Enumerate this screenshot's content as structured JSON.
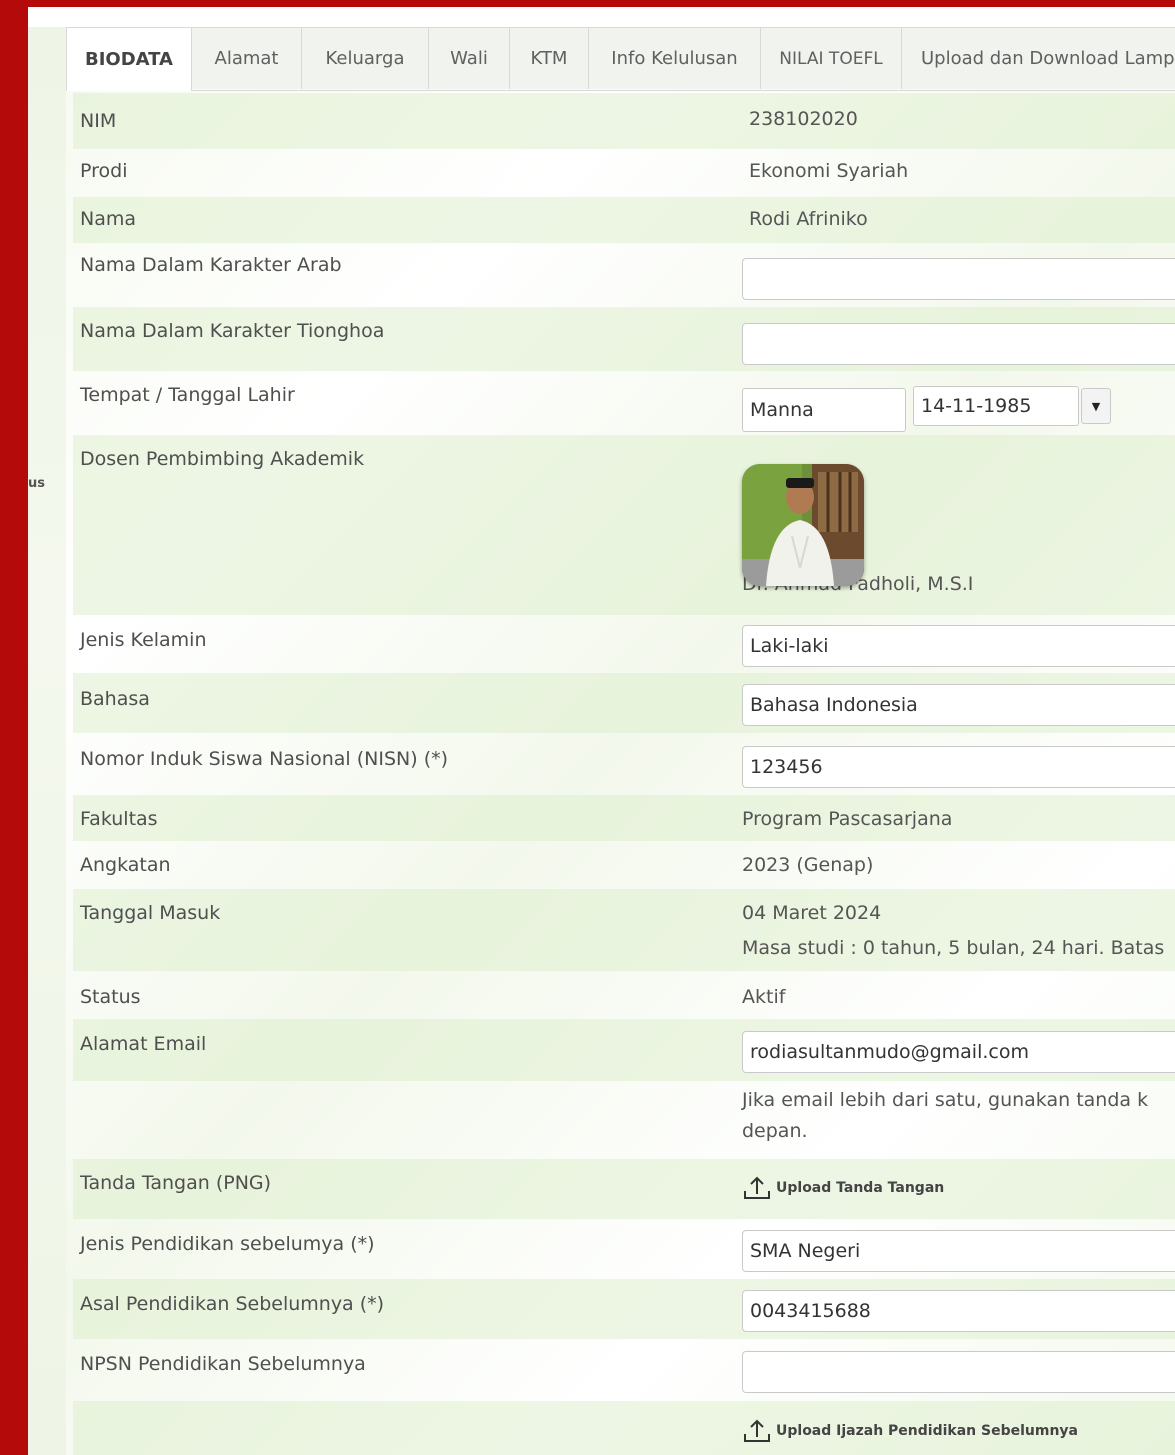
{
  "sidebar": {
    "partial_text": "us"
  },
  "tabs": [
    {
      "label": "BIODATA",
      "active": true
    },
    {
      "label": "Alamat"
    },
    {
      "label": "Keluarga"
    },
    {
      "label": "Wali"
    },
    {
      "label": "KTM"
    },
    {
      "label": "Info Kelulusan"
    },
    {
      "label": "NILAI TOEFL"
    },
    {
      "label": "Upload dan Download Lamp"
    }
  ],
  "form": {
    "nim": {
      "label": "NIM",
      "value": "238102020"
    },
    "prodi": {
      "label": "Prodi",
      "value": "Ekonomi Syariah"
    },
    "nama": {
      "label": "Nama",
      "value": "Rodi Afriniko"
    },
    "nama_arab": {
      "label": "Nama Dalam Karakter Arab",
      "value": ""
    },
    "nama_tionghoa": {
      "label": "Nama Dalam Karakter Tionghoa",
      "value": ""
    },
    "ttl": {
      "label": "Tempat / Tanggal Lahir",
      "tempat": "Manna",
      "tanggal": "14-11-1985"
    },
    "dosen": {
      "label": "Dosen Pembimbing Akademik",
      "name": "Dr. Ahmad Fadholi, M.S.I"
    },
    "jenis_kelamin": {
      "label": "Jenis Kelamin",
      "value": "Laki-laki"
    },
    "bahasa": {
      "label": "Bahasa",
      "value": "Bahasa Indonesia"
    },
    "nisn": {
      "label": "Nomor Induk Siswa Nasional (NISN) (*)",
      "value": "123456"
    },
    "fakultas": {
      "label": "Fakultas",
      "value": "Program Pascasarjana"
    },
    "angkatan": {
      "label": "Angkatan",
      "value": "2023 (Genap)"
    },
    "tanggal_masuk": {
      "label": "Tanggal Masuk",
      "value": "04 Maret 2024",
      "masa_studi": "Masa studi : 0 tahun, 5 bulan, 24 hari. Batas"
    },
    "status": {
      "label": "Status",
      "value": "Aktif"
    },
    "email": {
      "label": "Alamat Email",
      "value": "rodiasultanmudo@gmail.com",
      "hint_line1": "Jika email lebih dari satu, gunakan tanda k",
      "hint_line2": "depan."
    },
    "tanda_tangan": {
      "label": "Tanda Tangan (PNG)",
      "upload_label": "Upload Tanda Tangan"
    },
    "jenis_pendidikan": {
      "label": "Jenis Pendidikan sebelumya (*)",
      "value": "SMA Negeri"
    },
    "asal_pendidikan": {
      "label": "Asal Pendidikan Sebelumnya (*)",
      "value": "0043415688"
    },
    "npsn": {
      "label": "NPSN Pendidikan Sebelumnya",
      "value": ""
    },
    "ijazah": {
      "upload_label": "Upload Ijazah Pendidikan Sebelumnya"
    }
  },
  "icons": {
    "upload": "upload-icon",
    "dropdown": "caret-down-icon"
  }
}
